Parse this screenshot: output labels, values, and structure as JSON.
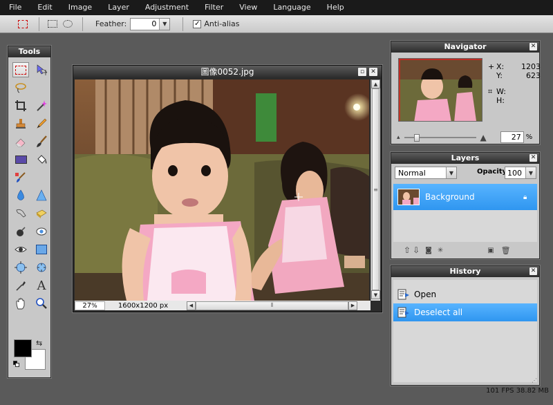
{
  "menu": [
    "File",
    "Edit",
    "Image",
    "Layer",
    "Adjustment",
    "Filter",
    "View",
    "Language",
    "Help"
  ],
  "options": {
    "feather_label": "Feather:",
    "feather_value": "0",
    "antialias_label": "Anti-alias",
    "antialias_checked": true
  },
  "tools": {
    "title": "Tools",
    "items": [
      "marquee-icon",
      "move-icon",
      "lasso-icon",
      "wand-icon",
      "crop-icon",
      "magic-wand-icon",
      "stamp-icon",
      "pencil-icon",
      "eraser-icon",
      "brush-icon",
      "rectangle-icon",
      "bucket-icon",
      "color-replace-icon",
      "blank",
      "drop-icon",
      "sharpen-icon",
      "smudge-icon",
      "sponge-icon",
      "burn-icon",
      "red-eye-icon",
      "eye-icon",
      "shape-icon",
      "bloat-icon",
      "pinch-icon",
      "picker-icon",
      "type-icon",
      "hand-icon",
      "zoom-icon"
    ],
    "type_glyph": "A",
    "fg_color": "#000000",
    "bg_color": "#ffffff"
  },
  "image_window": {
    "title": "圖像0052.jpg",
    "zoom": "27",
    "zoom_unit": "%",
    "size": "1600x1200 px"
  },
  "navigator": {
    "title": "Navigator",
    "x_label": "X:",
    "x_value": "1203",
    "y_label": "Y:",
    "y_value": "623",
    "w_label": "W:",
    "h_label": "H:",
    "zoom": "27",
    "zoom_unit": "%"
  },
  "layers": {
    "title": "Layers",
    "blend_mode": "Normal",
    "opacity_label": "Opacity:",
    "opacity_value": "100",
    "items": [
      {
        "name": "Background"
      }
    ]
  },
  "history": {
    "title": "History",
    "items": [
      {
        "label": "Open",
        "active": false
      },
      {
        "label": "Deselect all",
        "active": true
      }
    ]
  },
  "status": "101 FPS 38.82 MB",
  "colors": {
    "menubar": "#1a1a1a",
    "workspace": "#5a5a5a",
    "selection": "#3fa3f5"
  }
}
